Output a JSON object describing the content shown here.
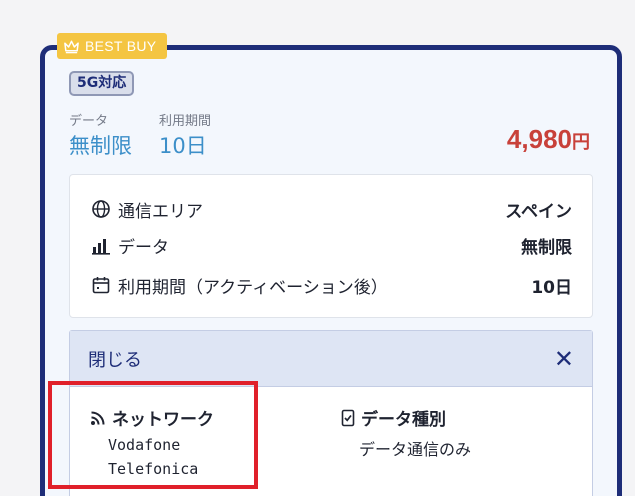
{
  "badge": {
    "label": "BEST BUY",
    "icon": "crown-icon"
  },
  "tag": "5G対応",
  "summary": {
    "data_label": "データ",
    "data_value": "無制限",
    "period_label": "利用期間",
    "period_value": "10日",
    "price_value": "4,980",
    "price_unit": "円"
  },
  "specs": [
    {
      "icon": "globe-icon",
      "key": "通信エリア",
      "value": "スペイン"
    },
    {
      "icon": "bar-chart-icon",
      "key": "データ",
      "value": "無制限"
    },
    {
      "icon": "calendar-icon",
      "key": "利用期間（アクティベーション後）",
      "value": "10日"
    }
  ],
  "details": {
    "toggle_label": "閉じる",
    "network_title": "ネットワーク",
    "networks": [
      "Vodafone",
      "Telefonica"
    ],
    "data_type_title": "データ種別",
    "data_type_value": "データ通信のみ"
  },
  "colors": {
    "border": "#1e2d78",
    "badge": "#f4c542",
    "price": "#c8413a",
    "accent": "#3c8fc9",
    "highlight": "#e0202a"
  }
}
